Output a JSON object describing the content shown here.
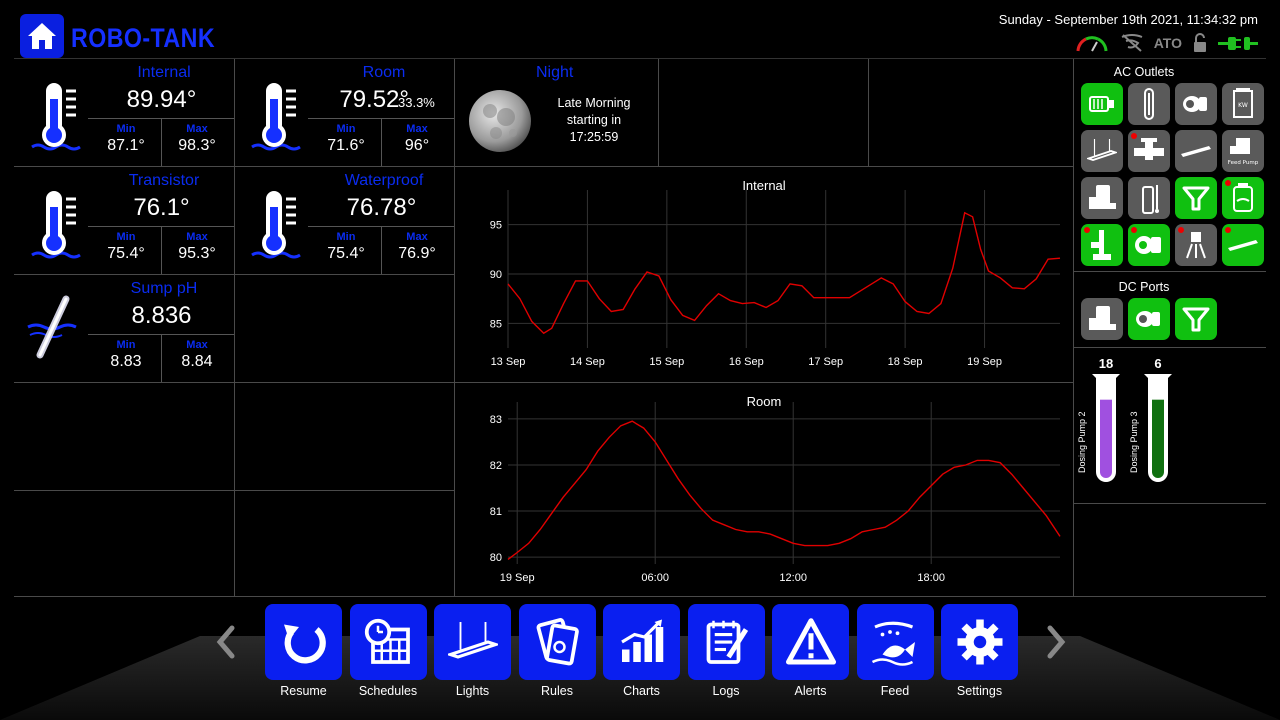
{
  "app": {
    "title": "ROBO-TANK",
    "datetime": "Sunday - September 19th 2021, 11:34:32 pm",
    "ato": "ATO"
  },
  "sensors": [
    {
      "name": "Internal",
      "value": "89.94°",
      "extra": "",
      "min_label": "Min",
      "min": "87.1°",
      "max_label": "Max",
      "max": "98.3°",
      "icon": "thermometer-icon"
    },
    {
      "name": "Room",
      "value": "79.52°",
      "extra": "33.3%",
      "min_label": "Min",
      "min": "71.6°",
      "max_label": "Max",
      "max": "96°",
      "icon": "thermometer-icon"
    },
    {
      "name": "Transistor",
      "value": "76.1°",
      "extra": "",
      "min_label": "Min",
      "min": "75.4°",
      "max_label": "Max",
      "max": "95.3°",
      "icon": "thermometer-icon"
    },
    {
      "name": "Waterproof",
      "value": "76.78°",
      "extra": "",
      "min_label": "Min",
      "min": "75.4°",
      "max_label": "Max",
      "max": "76.9°",
      "icon": "thermometer-icon"
    },
    {
      "name": "Sump pH",
      "value": "8.836",
      "extra": "",
      "min_label": "Min",
      "min": "8.83",
      "max_label": "Max",
      "max": "8.84",
      "icon": "ph-probe-icon"
    }
  ],
  "moon": {
    "name": "Night",
    "line1": "Late Morning",
    "line2": "starting in",
    "line3": "17:25:59"
  },
  "outlets": {
    "title": "AC Outlets",
    "items": [
      {
        "icon": "pump-icon",
        "on": true,
        "alert": false
      },
      {
        "icon": "heater-icon",
        "on": false,
        "alert": false
      },
      {
        "icon": "wavemaker-icon",
        "on": false,
        "alert": false
      },
      {
        "icon": "power-meter-icon",
        "on": false,
        "alert": false
      },
      {
        "icon": "light-fixture-icon",
        "on": false,
        "alert": false
      },
      {
        "icon": "valve-icon",
        "on": false,
        "alert": true
      },
      {
        "icon": "led-bar-icon",
        "on": false,
        "alert": false
      },
      {
        "icon": "feed-pump-icon",
        "on": false,
        "alert": false
      },
      {
        "icon": "skimmer-icon",
        "on": false,
        "alert": false
      },
      {
        "icon": "reactor-icon",
        "on": false,
        "alert": false
      },
      {
        "icon": "filter-icon",
        "on": true,
        "alert": false
      },
      {
        "icon": "reservoir-icon",
        "on": true,
        "alert": true
      },
      {
        "icon": "uv-sterilizer-icon",
        "on": true,
        "alert": true
      },
      {
        "icon": "return-pump-icon",
        "on": true,
        "alert": true
      },
      {
        "icon": "sprinkler-icon",
        "on": false,
        "alert": true
      },
      {
        "icon": "light-strip-icon",
        "on": true,
        "alert": true
      }
    ]
  },
  "dc_ports": {
    "title": "DC Ports",
    "items": [
      {
        "icon": "skimmer-icon",
        "on": false
      },
      {
        "icon": "wavemaker-icon",
        "on": true
      },
      {
        "icon": "filter-icon",
        "on": true
      }
    ]
  },
  "dosing": [
    {
      "name": "Dosing Pump 2",
      "count": "18",
      "color": "#a050e0",
      "level": 0.83
    },
    {
      "name": "Dosing Pump 3",
      "count": "6",
      "color": "#107010",
      "level": 0.83
    }
  ],
  "nav": [
    {
      "label": "Resume",
      "icon": "resume-icon"
    },
    {
      "label": "Schedules",
      "icon": "calendar-clock-icon"
    },
    {
      "label": "Lights",
      "icon": "light-fixture-icon"
    },
    {
      "label": "Rules",
      "icon": "rules-icon"
    },
    {
      "label": "Charts",
      "icon": "bar-chart-icon"
    },
    {
      "label": "Logs",
      "icon": "log-icon"
    },
    {
      "label": "Alerts",
      "icon": "warning-icon"
    },
    {
      "label": "Feed",
      "icon": "fish-icon"
    },
    {
      "label": "Settings",
      "icon": "gear-icon"
    }
  ],
  "chart_data": [
    {
      "type": "line",
      "title": "Internal",
      "xlabel": "",
      "ylabel": "",
      "x_ticks": [
        "13 Sep",
        "14 Sep",
        "15 Sep",
        "16 Sep",
        "17 Sep",
        "18 Sep",
        "19 Sep"
      ],
      "y_ticks": [
        85,
        90,
        95
      ],
      "xlim": [
        0,
        6.95
      ],
      "ylim": [
        82.5,
        97.5
      ],
      "grid": true,
      "color": "#e00000",
      "series": [
        {
          "x": [
            0,
            0.15,
            0.3,
            0.45,
            0.55,
            0.7,
            0.85,
            1.0,
            1.15,
            1.3,
            1.45,
            1.6,
            1.75,
            1.9,
            2.05,
            2.2,
            2.35,
            2.5,
            2.65,
            2.8,
            2.95,
            3.1,
            3.25,
            3.4,
            3.55,
            3.7,
            3.85,
            4.0,
            4.15,
            4.3,
            4.5,
            4.7,
            4.85,
            5.0,
            5.15,
            5.3,
            5.45,
            5.6,
            5.75,
            5.85,
            5.95,
            6.05,
            6.2,
            6.35,
            6.5,
            6.65,
            6.8,
            6.95
          ],
          "y": [
            89,
            87.5,
            85.2,
            84,
            84.5,
            87,
            89.3,
            89.3,
            87.5,
            86.2,
            86.4,
            88.5,
            90.2,
            89.8,
            87.4,
            85.8,
            85.3,
            86.8,
            88,
            87.3,
            87,
            87.1,
            86.6,
            87.3,
            89,
            88.8,
            87.6,
            87.6,
            87.6,
            87.6,
            88.6,
            89.6,
            89,
            87.2,
            86.2,
            86,
            87,
            90.6,
            96.2,
            95.8,
            92.5,
            90.3,
            89.6,
            88.6,
            88.5,
            89.5,
            91.5,
            91.6
          ]
        }
      ]
    },
    {
      "type": "line",
      "title": "Room",
      "xlabel": "",
      "ylabel": "",
      "x_ticks": [
        "19 Sep",
        "06:00",
        "12:00",
        "18:00"
      ],
      "y_ticks": [
        80,
        81,
        82,
        83
      ],
      "xlim": [
        -0.4,
        23.6
      ],
      "ylim": [
        79.85,
        83.15
      ],
      "grid": true,
      "color": "#e00000",
      "series": [
        {
          "x": [
            -0.4,
            0,
            0.5,
            1,
            1.5,
            2,
            2.5,
            3,
            3.5,
            4,
            4.5,
            5,
            5.5,
            6,
            6.5,
            7,
            7.5,
            8,
            8.5,
            9,
            9.5,
            10,
            10.5,
            11,
            11.5,
            12,
            12.5,
            13,
            13.5,
            14,
            14.5,
            15,
            15.5,
            16,
            16.5,
            17,
            17.5,
            18,
            18.5,
            19,
            19.5,
            20,
            20.5,
            21,
            21.5,
            22,
            22.5,
            23,
            23.6
          ],
          "y": [
            79.95,
            80.1,
            80.3,
            80.6,
            80.95,
            81.3,
            81.6,
            81.9,
            82.3,
            82.6,
            82.85,
            82.95,
            82.8,
            82.5,
            82.1,
            81.7,
            81.35,
            81.05,
            80.8,
            80.7,
            80.6,
            80.55,
            80.55,
            80.5,
            80.4,
            80.3,
            80.25,
            80.25,
            80.25,
            80.3,
            80.4,
            80.55,
            80.6,
            80.65,
            80.8,
            81.0,
            81.3,
            81.55,
            81.8,
            81.95,
            82.0,
            82.1,
            82.1,
            82.05,
            81.8,
            81.5,
            81.2,
            80.9,
            80.45
          ]
        }
      ]
    }
  ]
}
